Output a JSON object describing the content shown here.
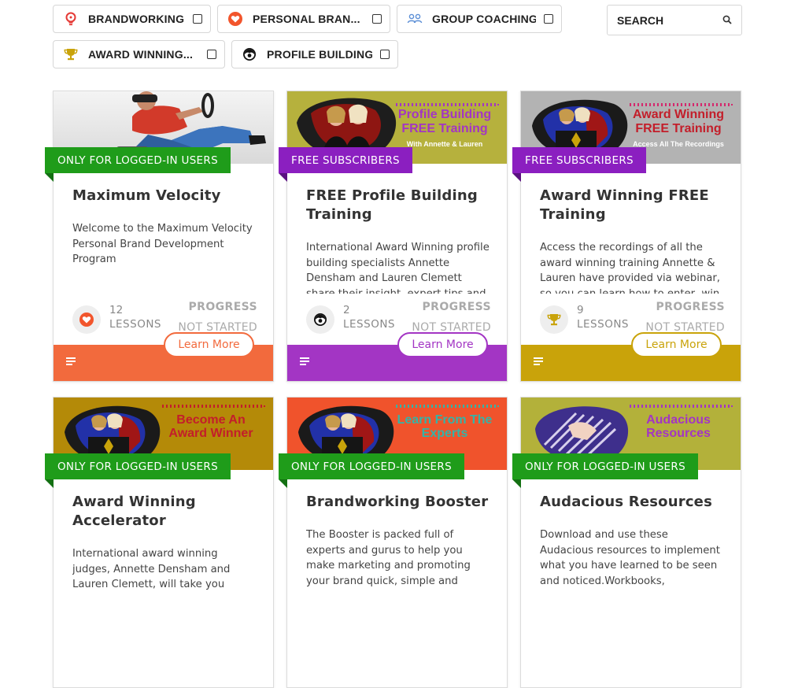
{
  "filters": [
    {
      "label": "BRANDWORKING",
      "icon": "lightbulb-icon"
    },
    {
      "label": "PERSONAL BRAN...",
      "icon": "heart-icon"
    },
    {
      "label": "GROUP COACHING",
      "icon": "group-icon"
    },
    {
      "label": "AWARD WINNING...",
      "icon": "trophy-icon"
    },
    {
      "label": "PROFILE BUILDING",
      "icon": "profile-icon"
    }
  ],
  "search": {
    "label": "SEARCH",
    "icon": "search-icon"
  },
  "cards": [
    {
      "tag": "ONLY FOR LOGGED-IN USERS",
      "tag_color": "#1f9c1a",
      "title": "Maximum Velocity",
      "description": "Welcome to the Maximum Velocity Personal Brand Development Program",
      "lessons_count": "12",
      "lessons_label": "LESSONS",
      "progress_label": "PROGRESS",
      "progress_value": "NOT STARTED",
      "learn_more": "Learn More",
      "footer_color": "#f26a3d",
      "icon": "heart-icon"
    },
    {
      "tag": "FREE SUBSCRIBERS",
      "tag_color": "#8b1fc0",
      "title": "FREE Profile Building Training",
      "description": "International Award Winning profile building specialists Annette Densham and Lauren Clemett share their insight, expert tips and",
      "lessons_count": "2",
      "lessons_label": "LESSONS",
      "progress_label": "PROGRESS",
      "progress_value": "NOT STARTED",
      "learn_more": "Learn More",
      "footer_color": "#a335c4",
      "icon": "profile-icon",
      "banner_line1": "Profile Building",
      "banner_line2": "FREE Training",
      "banner_line3": "With Annette & Lauren"
    },
    {
      "tag": "FREE SUBSCRIBERS",
      "tag_color": "#8b1fc0",
      "title": "Award Winning FREE Training",
      "description": "Access the recordings of all the award winning training Annette & Lauren have provided via webinar, so you can learn how to enter, win",
      "lessons_count": "9",
      "lessons_label": "LESSONS",
      "progress_label": "PROGRESS",
      "progress_value": "NOT STARTED",
      "learn_more": "Learn More",
      "footer_color": "#c9a30a",
      "icon": "trophy-icon",
      "banner_line1": "Award Winning",
      "banner_line2": "FREE Training",
      "banner_line3": "Access All The Recordings"
    },
    {
      "tag": "ONLY FOR LOGGED-IN USERS",
      "tag_color": "#1f9c1a",
      "title": "Award Winning Accelerator",
      "description": "International award winning judges, Annette Densham and Lauren Clemett, will take you",
      "banner_line1": "Become An",
      "banner_line2": "Award Winner"
    },
    {
      "tag": "ONLY FOR LOGGED-IN USERS",
      "tag_color": "#1f9c1a",
      "title": "Brandworking Booster",
      "description": "The Booster is packed full of experts and gurus to help you make marketing and promoting your brand quick, simple and",
      "banner_line1": "Learn From The",
      "banner_line2": "Experts"
    },
    {
      "tag": "ONLY FOR LOGGED-IN USERS",
      "tag_color": "#1f9c1a",
      "title": "Audacious Resources",
      "description": "Download and use these Audacious resources to implement what you have learned to be seen and noticed.Workbooks,",
      "banner_line1": "Audacious",
      "banner_line2": "Resources"
    }
  ]
}
